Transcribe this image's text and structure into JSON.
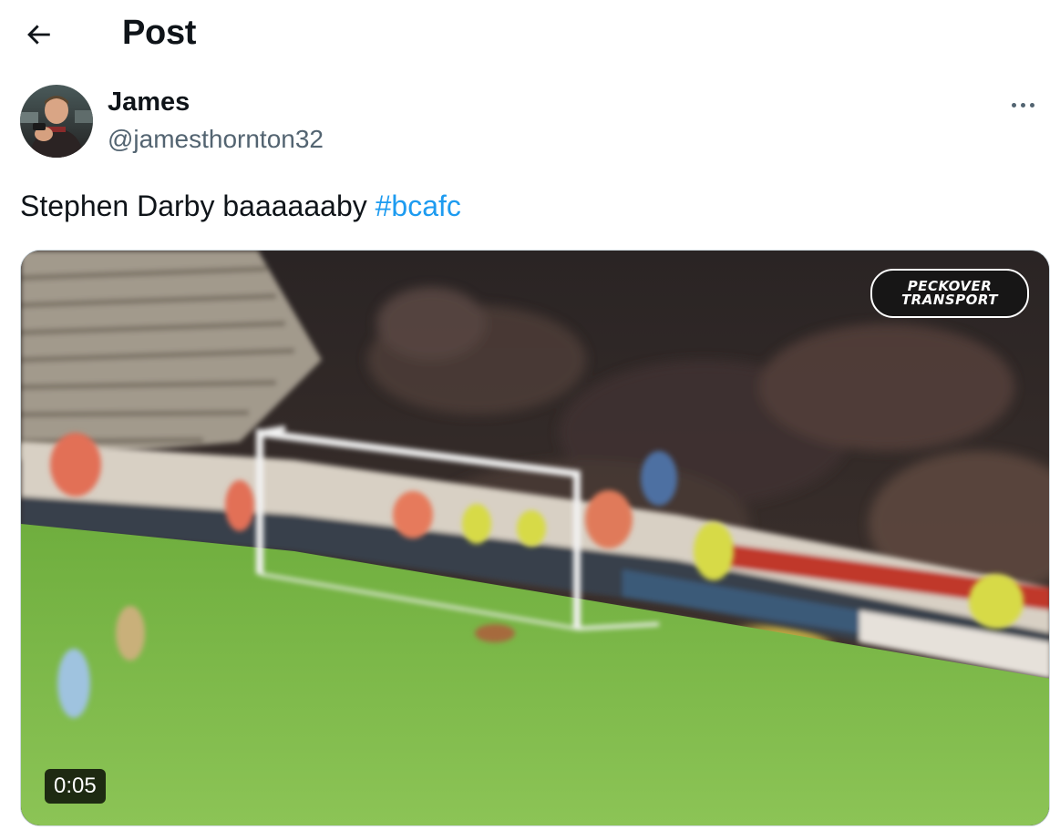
{
  "header": {
    "back_icon": "arrow-left-icon",
    "title": "Post"
  },
  "author": {
    "display_name": "James",
    "handle": "@jamesthornton32",
    "more_icon": "more-horizontal-icon"
  },
  "tweet": {
    "text": "Stephen Darby baaaaaaby ",
    "hashtag": "#bcafc"
  },
  "media": {
    "type": "video",
    "duration": "0:05",
    "sponsor_line1": "PECKOVER",
    "sponsor_line2": "TRANSPORT"
  },
  "colors": {
    "link": "#1d9bf0",
    "secondary_text": "#536471",
    "border": "#cfd9de"
  }
}
